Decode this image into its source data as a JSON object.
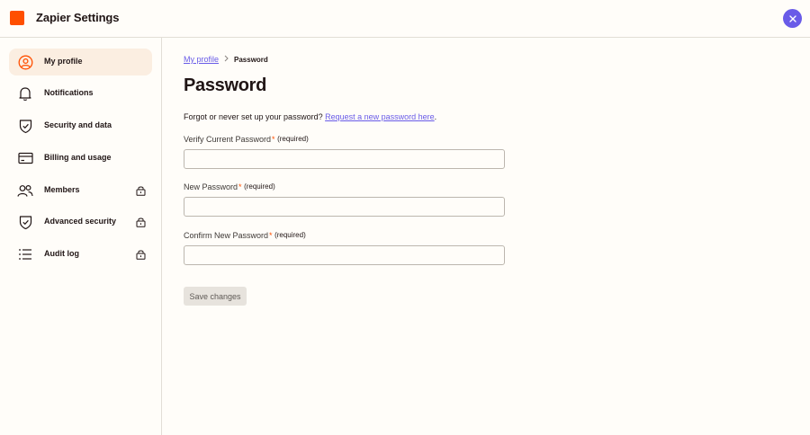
{
  "header": {
    "title": "Zapier Settings",
    "logo_color": "#ff4f00",
    "close_icon": "close-icon",
    "accent": "#695be8"
  },
  "sidebar": {
    "items": [
      {
        "label": "My profile",
        "icon": "user-circle-icon",
        "active": true,
        "locked": false
      },
      {
        "label": "Notifications",
        "icon": "bell-icon",
        "active": false,
        "locked": false
      },
      {
        "label": "Security and data",
        "icon": "shield-check-icon",
        "active": false,
        "locked": false
      },
      {
        "label": "Billing and usage",
        "icon": "credit-card-icon",
        "active": false,
        "locked": false
      },
      {
        "label": "Members",
        "icon": "users-icon",
        "active": false,
        "locked": true
      },
      {
        "label": "Advanced security",
        "icon": "shield-check-icon",
        "active": false,
        "locked": true
      },
      {
        "label": "Audit log",
        "icon": "list-icon",
        "active": false,
        "locked": true
      }
    ]
  },
  "main": {
    "breadcrumb": {
      "parent": "My profile",
      "current": "Password"
    },
    "title": "Password",
    "forgot": {
      "prefix": "Forgot or never set up your password?",
      "link": "Request a new password here",
      "suffix": "."
    },
    "fields": [
      {
        "label": "Verify Current Password",
        "required_mark": "*",
        "required_text": "(required)",
        "value": "",
        "placeholder": ""
      },
      {
        "label": "New Password",
        "required_mark": "*",
        "required_text": "(required)",
        "value": "",
        "placeholder": ""
      },
      {
        "label": "Confirm New Password",
        "required_mark": "*",
        "required_text": "(required)",
        "value": "",
        "placeholder": ""
      }
    ],
    "save_label": "Save changes"
  }
}
